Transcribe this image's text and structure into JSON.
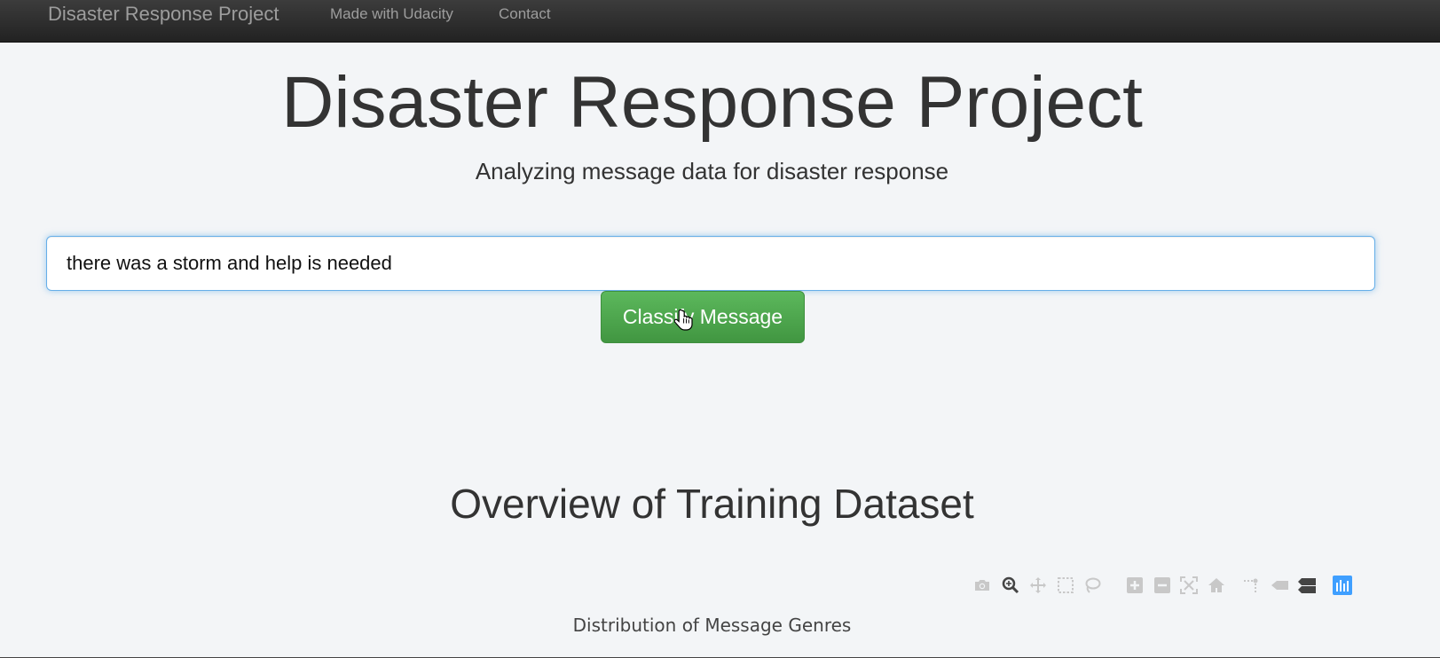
{
  "navbar": {
    "brand": "Disaster Response Project",
    "links": [
      {
        "label": "Made with Udacity"
      },
      {
        "label": "Contact"
      }
    ]
  },
  "hero": {
    "title": "Disaster Response Project",
    "subtitle": "Analyzing message data for disaster response"
  },
  "classify_form": {
    "message_value": "there was a storm and help is needed",
    "button_label": "Classify Message"
  },
  "overview": {
    "title": "Overview of Training Dataset"
  },
  "modebar": {
    "icons": [
      "camera-icon",
      "zoom-icon",
      "pan-icon",
      "box-select-icon",
      "lasso-select-icon",
      "zoom-in-icon",
      "zoom-out-icon",
      "autoscale-icon",
      "reset-axes-icon",
      "spike-lines-icon",
      "hover-closest-icon",
      "hover-compare-icon",
      "plotly-logo-icon"
    ],
    "active_color": "#444444",
    "inactive_color": "#c8c8c8",
    "logo_color": "#3f9fff"
  },
  "chart": {
    "title": "Distribution of Message Genres"
  }
}
